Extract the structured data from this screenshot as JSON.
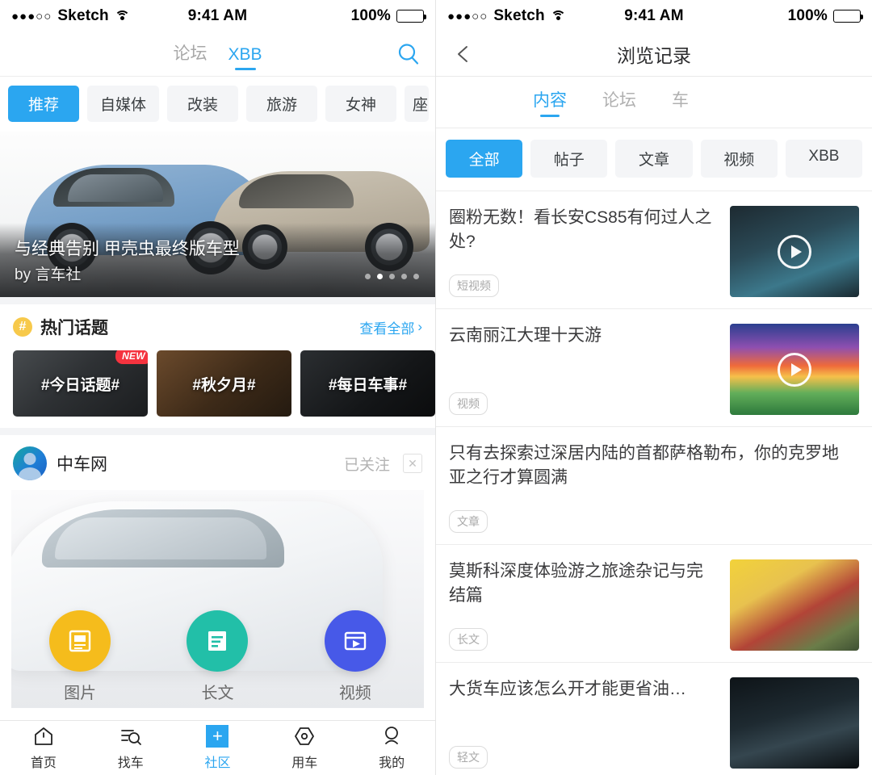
{
  "status_bar": {
    "signal_dots": "●●●○○",
    "carrier": "Sketch",
    "wifi_icon": "wifi-icon",
    "time": "9:41 AM",
    "battery_percent": "100%",
    "battery_icon": "battery-full-icon"
  },
  "left_screen": {
    "nav": {
      "tabs": [
        {
          "label": "论坛",
          "active": false
        },
        {
          "label": "XBB",
          "active": true
        }
      ],
      "search_icon": "search-icon"
    },
    "categories": [
      {
        "label": "推荐",
        "active": true
      },
      {
        "label": "自媒体",
        "active": false
      },
      {
        "label": "改装",
        "active": false
      },
      {
        "label": "旅游",
        "active": false
      },
      {
        "label": "女神",
        "active": false
      },
      {
        "label": "座",
        "active": false
      }
    ],
    "hero": {
      "title": "与经典告别 甲壳虫最终版车型",
      "byline": "by 言车社",
      "dots_total": 5,
      "dots_active_index": 1
    },
    "hot_topics": {
      "icon": "hash-icon",
      "title": "热门话题",
      "more_label": "查看全部",
      "more_chevron": "chevron-right-icon",
      "cards": [
        {
          "label": "#今日话题#",
          "badge": "NEW"
        },
        {
          "label": "#秋夕月#",
          "badge": ""
        },
        {
          "label": "#每日车事#",
          "badge": ""
        },
        {
          "label": "",
          "badge": ""
        }
      ]
    },
    "account": {
      "avatar_icon": "avatar-icon",
      "name": "中车网",
      "follow_label": "已关注",
      "close_icon": "close-icon"
    },
    "publish_actions": [
      {
        "label": "图片",
        "icon": "image-post-icon",
        "color": "#f5bc1c"
      },
      {
        "label": "长文",
        "icon": "long-article-icon",
        "color": "#22bfa8"
      },
      {
        "label": "视频",
        "icon": "video-post-icon",
        "color": "#4759e8"
      }
    ],
    "tabbar": [
      {
        "label": "首页",
        "icon": "home-icon",
        "active": false
      },
      {
        "label": "找车",
        "icon": "find-car-icon",
        "active": false
      },
      {
        "label": "社区",
        "icon": "plus-icon",
        "active": true
      },
      {
        "label": "用车",
        "icon": "hexagon-car-icon",
        "active": false
      },
      {
        "label": "我的",
        "icon": "person-icon",
        "active": false
      }
    ]
  },
  "right_screen": {
    "nav": {
      "back_icon": "chevron-left-icon",
      "title": "浏览记录"
    },
    "tabs": [
      {
        "label": "内容",
        "active": true
      },
      {
        "label": "论坛",
        "active": false
      },
      {
        "label": "车",
        "active": false
      }
    ],
    "filters": [
      {
        "label": "全部",
        "active": true
      },
      {
        "label": "帖子",
        "active": false
      },
      {
        "label": "文章",
        "active": false
      },
      {
        "label": "视频",
        "active": false
      },
      {
        "label": "XBB",
        "active": false
      }
    ],
    "history": [
      {
        "title": "圈粉无数！看长安CS85有何过人之处?",
        "tag": "短视频",
        "thumb": "th-cs85",
        "has_thumb": true,
        "has_play": true
      },
      {
        "title": "云南丽江大理十天游",
        "tag": "视频",
        "thumb": "th-lijiang",
        "has_thumb": true,
        "has_play": true
      },
      {
        "title": "只有去探索过深居内陆的首都萨格勒布，你的克罗地亚之行才算圆满",
        "tag": "文章",
        "thumb": "",
        "has_thumb": false,
        "has_play": false
      },
      {
        "title": "莫斯科深度体验游之旅途杂记与完结篇",
        "tag": "长文",
        "thumb": "th-moscow",
        "has_thumb": true,
        "has_play": false
      },
      {
        "title": "大货车应该怎么开才能更省油…",
        "tag": "轻文",
        "thumb": "th-truck",
        "has_thumb": true,
        "has_play": false
      }
    ]
  },
  "colors": {
    "accent_blue": "#2ba6f0",
    "badge_red": "#f5333f",
    "hash_yellow": "#f7c94b",
    "chip_bg": "#f4f5f7"
  }
}
